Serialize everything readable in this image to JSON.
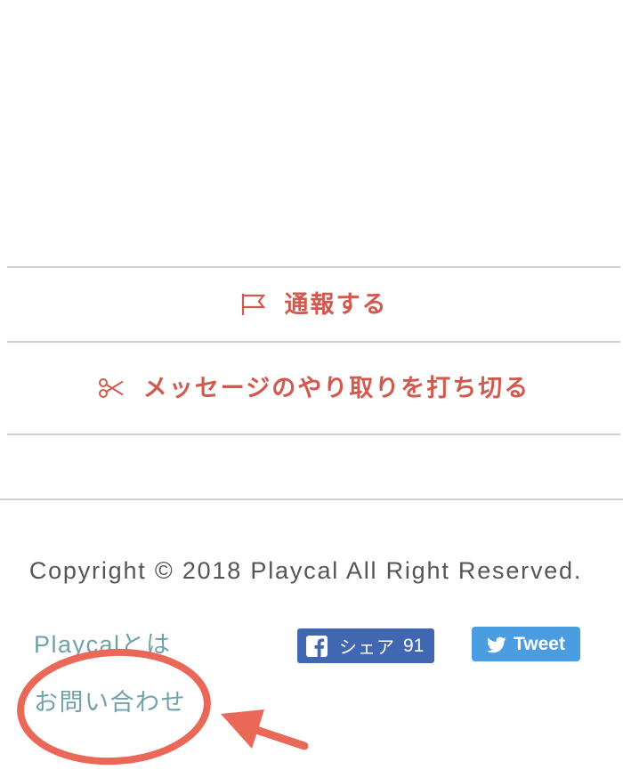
{
  "actions": {
    "report": {
      "label": "通報する",
      "icon": "flag-icon"
    },
    "end_conversation": {
      "label": "メッセージのやり取りを打ち切る",
      "icon": "scissors-icon"
    }
  },
  "footer": {
    "copyright": "Copyright © 2018 Playcal All Right Reserved.",
    "links": [
      {
        "label": "Playcalとは"
      },
      {
        "label": "お問い合わせ"
      }
    ],
    "facebook_share": {
      "label": "シェア",
      "count": "91",
      "icon": "facebook-icon"
    },
    "tweet": {
      "label": "Tweet",
      "icon": "twitter-bird-icon"
    }
  },
  "colors": {
    "action_red": "#d05a4e",
    "divider": "#d0d0d0",
    "text_gray": "#555555",
    "link_teal": "#72a2a8",
    "facebook_blue": "#4267b2",
    "twitter_blue": "#4a9de1",
    "annotation_red": "#ea6857"
  }
}
